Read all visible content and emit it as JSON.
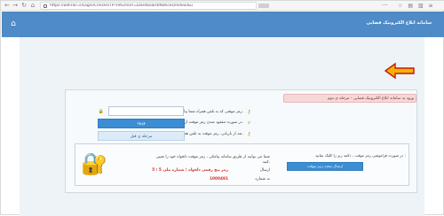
{
  "browser": {
    "back_icon": "arrow-left-icon",
    "forward_icon": "arrow-right-icon",
    "refresh_icon": "refresh-icon",
    "home_icon": "home-icon",
    "url": "https://adliran.ir/Login/CheckOTP?returnUrl=Dashboard/Notices/Index/&u",
    "menu_dots": "···",
    "toolbar_icons": [
      "star-icon",
      "bookmark-icon",
      "library-icon",
      "menu-icon"
    ]
  },
  "header": {
    "title": "سامانه ابلاغ الکترونیک قضایی",
    "brand_color": "#4f8bc6",
    "home_icon": "home-icon"
  },
  "stage": {
    "label": "ورود به سامانه ابلاغ الکترونیک قضایی - مرحله ی دوم"
  },
  "messages": [
    {
      "icon": "key-icon",
      "text": "رمز موقتی که به تلفن همراه شما پیامک شده را در کادر مربوطه وارد نمایید."
    },
    {
      "icon": "search-icon",
      "text": "در صورت مفقود شدن رمز موقت از گزینه ی ارسال مجدد رمز، مستقیما بازیابی نمایید."
    },
    {
      "icon": "key-icon",
      "text": "بعد از بازیابی، رمز موقت به تلفن همراه شما پیامک می شود."
    }
  ],
  "form": {
    "password_label": "رمز موقت *",
    "password_placeholder": "",
    "password_icon": "lock-icon",
    "enter_label": "ورود",
    "previous_label": "مرحله ی قبل"
  },
  "info": {
    "right_note": "در صورت فراموشی رمز موقت ، دکمه زیر را کلیک نمایید :",
    "send_button": "ارسال مجدد رمز موقت",
    "line1": "شما می توانید از طریق سامانه پیامکی ، رمز موقت دلخواه خود را تعیین",
    "line2": "کنید.",
    "send_label": "ارسال",
    "sms_line": "رمز پنج رقمی دلخواه ؛ شماره ملی 5 ؛ 5",
    "to_number_label": "به شماره",
    "number": "1000491",
    "shield_icon": "lock-shield-icon"
  }
}
